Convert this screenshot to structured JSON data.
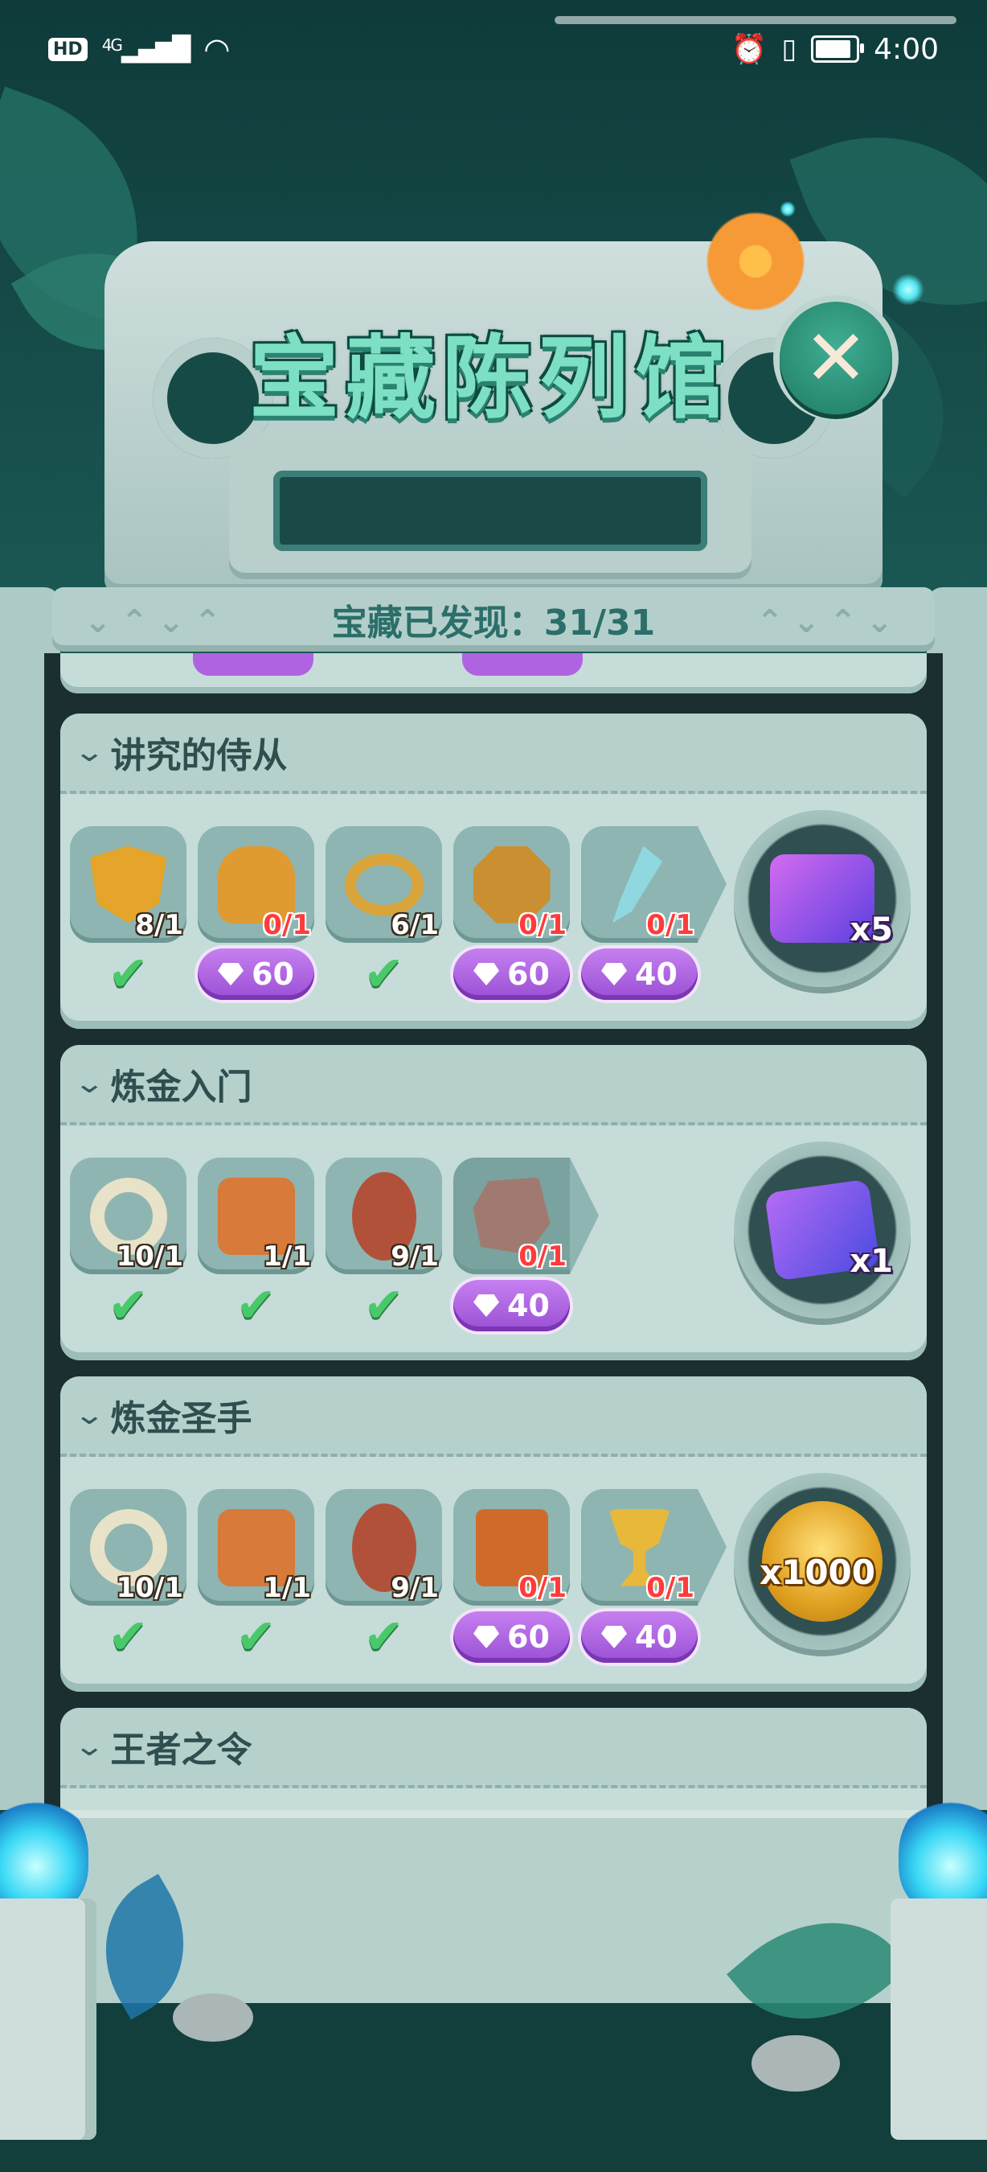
{
  "status_bar": {
    "hd": "HD",
    "network": "4G",
    "signal_icon": "signal-bars",
    "wifi_icon": "wifi",
    "alarm_icon": "alarm-clock",
    "vibrate_icon": "vibrate",
    "battery_icon": "battery-full",
    "time": "4:00"
  },
  "header": {
    "title": "宝藏陈列馆",
    "close_icon": "close-x",
    "found_text": "宝藏已发现：31/31"
  },
  "colors": {
    "background": "#1c5a56",
    "title_fill": "#7de0c4",
    "gem_button": "#b063e0",
    "check_green": "#49c96a",
    "count_red": "#ff3b3b"
  },
  "sections": [
    {
      "title": "讲究的侍从",
      "items": [
        {
          "icon": "mickey-shield",
          "count": "8/1",
          "status": "check",
          "color": "#e5a52a"
        },
        {
          "icon": "chest-armor",
          "count": "0/1",
          "status": "gem",
          "price": "60",
          "color": "#e09a32"
        },
        {
          "icon": "gold-belt",
          "count": "6/1",
          "status": "check",
          "color": "#d9a43a"
        },
        {
          "icon": "mickey-medal",
          "count": "0/1",
          "status": "gem",
          "price": "60",
          "color": "#c98f30"
        },
        {
          "icon": "crystal-sword",
          "count": "0/1",
          "status": "gem",
          "price": "40",
          "color": "#8fd8e0"
        }
      ],
      "reward": {
        "icon": "mystery-ticket",
        "qty": "x5",
        "color": "#8a4be0"
      }
    },
    {
      "title": "炼金入门",
      "items": [
        {
          "icon": "bone-ring",
          "count": "10/1",
          "status": "check",
          "color": "#e8e2c8"
        },
        {
          "icon": "tiki-mask",
          "count": "1/1",
          "status": "check",
          "color": "#d77a3a"
        },
        {
          "icon": "tribal-shield",
          "count": "9/1",
          "status": "check",
          "color": "#b2513a"
        },
        {
          "icon": "stone-tablet",
          "count": "0/1",
          "status": "gem",
          "price": "40",
          "color": "#a07a70"
        }
      ],
      "reward": {
        "icon": "mickey-card",
        "qty": "x1",
        "color": "#7a55e8"
      }
    },
    {
      "title": "炼金圣手",
      "items": [
        {
          "icon": "bone-ring",
          "count": "10/1",
          "status": "check",
          "color": "#e8e2c8"
        },
        {
          "icon": "tiki-mask",
          "count": "1/1",
          "status": "check",
          "color": "#d77a3a"
        },
        {
          "icon": "tribal-shield",
          "count": "9/1",
          "status": "check",
          "color": "#b2513a"
        },
        {
          "icon": "spell-book",
          "count": "0/1",
          "status": "gem",
          "price": "60",
          "color": "#d06a2a"
        },
        {
          "icon": "gold-trophy",
          "count": "0/1",
          "status": "gem",
          "price": "40",
          "color": "#e8b83a"
        }
      ],
      "reward": {
        "icon": "gold-coins",
        "qty": "x1000",
        "color": "#f2b82a"
      }
    },
    {
      "title": "王者之令"
    }
  ]
}
